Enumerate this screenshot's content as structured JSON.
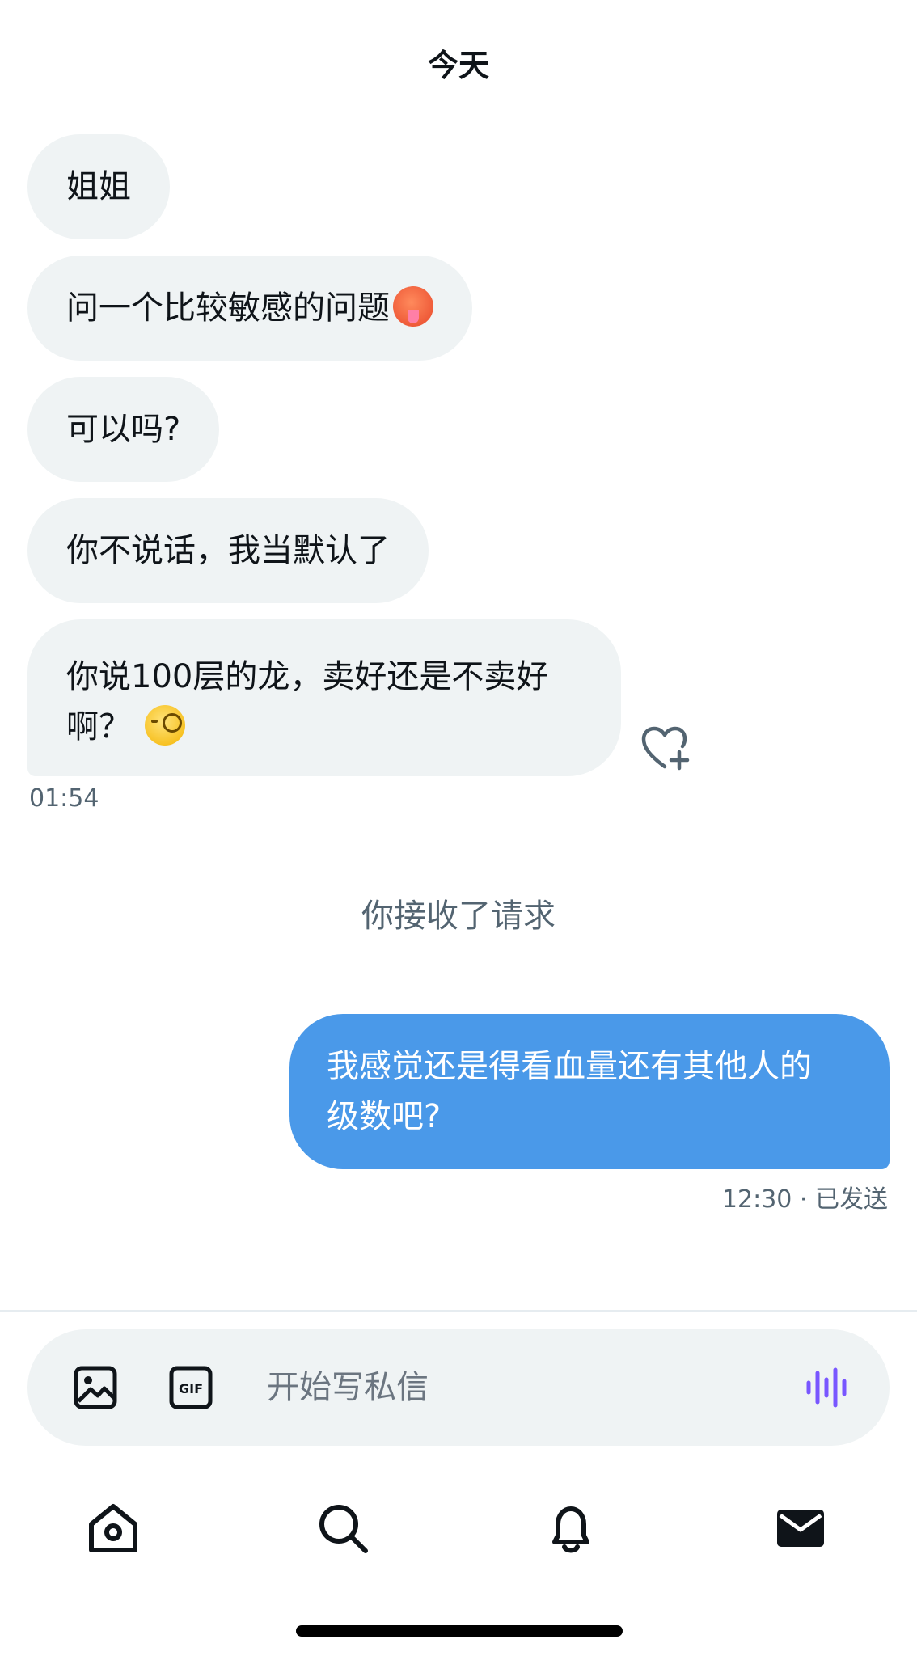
{
  "header": {
    "day_label": "今天"
  },
  "incoming_messages": [
    {
      "text": "姐姐"
    },
    {
      "text": "问一个比较敏感的问题",
      "emoji": "hot-face-emoji"
    },
    {
      "text": "可以吗?"
    },
    {
      "text": "你不说话，我当默认了"
    },
    {
      "line1": "你说100层的龙，卖好还是不卖好",
      "line2": "啊？",
      "emoji": "monocle-face-emoji"
    }
  ],
  "incoming_time": "01:54",
  "system_note": "你接收了请求",
  "outgoing_message": {
    "line1": "我感觉还是得看血量还有其他人的",
    "line2": "级数吧?"
  },
  "outgoing_status": "12:30 · 已发送",
  "composer": {
    "placeholder": "开始写私信"
  },
  "icons": [
    "image-icon",
    "gif-icon",
    "voice-icon",
    "heart-plus-icon",
    "home-icon",
    "search-icon",
    "bell-icon",
    "mail-icon"
  ],
  "colors": {
    "incoming_bubble": "#eff3f4",
    "outgoing_bubble": "#4a99e9",
    "voice_accent": "#7856ff",
    "muted_text": "#536471"
  }
}
